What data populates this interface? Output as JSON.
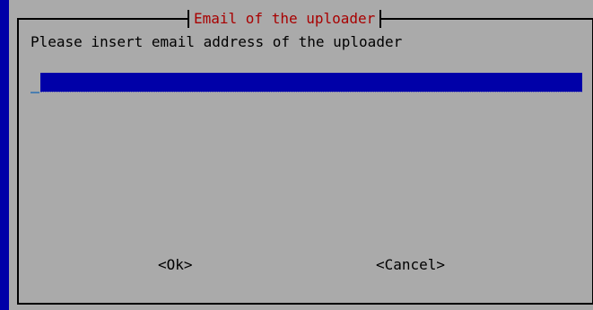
{
  "dialog": {
    "title": "Email of the uploader",
    "prompt": "Please insert email address of the uploader",
    "input": {
      "value": ""
    },
    "buttons": {
      "ok_label": "<Ok>",
      "cancel_label": "<Cancel>"
    }
  },
  "colors": {
    "background": "#0000a8",
    "dialog": "#aaaaaa",
    "title": "#a80000",
    "input_field": "#0000a8"
  }
}
